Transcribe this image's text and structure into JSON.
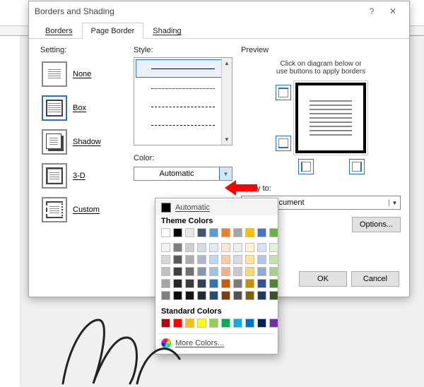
{
  "dialog": {
    "title": "Borders and Shading",
    "help_label": "?",
    "close_label": "✕"
  },
  "tabs": {
    "borders": "Borders",
    "page_border": "Page Border",
    "shading": "Shading"
  },
  "setting": {
    "heading": "Setting:",
    "none": "None",
    "box": "Box",
    "shadow": "Shadow",
    "threed": "3-D",
    "custom": "Custom"
  },
  "style": {
    "heading": "Style:",
    "color_heading": "Color:",
    "color_value": "Automatic"
  },
  "preview": {
    "heading": "Preview",
    "hint1": "Click on diagram below or",
    "hint2": "use buttons to apply borders"
  },
  "apply": {
    "heading": "Apply to:",
    "value": "Whole document"
  },
  "buttons": {
    "options": "Options...",
    "ok": "OK",
    "cancel": "Cancel"
  },
  "color_picker": {
    "automatic": "Automatic",
    "theme_heading": "Theme Colors",
    "standard_heading": "Standard Colors",
    "more": "More Colors...",
    "theme_row": [
      "#ffffff",
      "#000000",
      "#e7e6e6",
      "#44546a",
      "#5b9bd5",
      "#ed7d31",
      "#a5a5a5",
      "#ffc000",
      "#4472c4",
      "#70ad47"
    ],
    "theme_shades": [
      [
        "#f2f2f2",
        "#7f7f7f",
        "#d0cece",
        "#d6dce4",
        "#deebf6",
        "#fbe5d5",
        "#ededed",
        "#fff2cc",
        "#d9e2f3",
        "#e2efd9"
      ],
      [
        "#d8d8d8",
        "#595959",
        "#aeabab",
        "#adb9ca",
        "#bdd7ee",
        "#f7cbac",
        "#dbdbdb",
        "#fee599",
        "#b4c6e7",
        "#c5e0b3"
      ],
      [
        "#bfbfbf",
        "#3f3f3f",
        "#757070",
        "#8496b0",
        "#9cc3e5",
        "#f4b183",
        "#c9c9c9",
        "#ffd965",
        "#8eaadb",
        "#a8d08d"
      ],
      [
        "#a5a5a5",
        "#262626",
        "#3a3838",
        "#323f4f",
        "#2e75b5",
        "#c55a11",
        "#7b7b7b",
        "#bf9000",
        "#2f5496",
        "#538135"
      ],
      [
        "#7f7f7f",
        "#0c0c0c",
        "#171616",
        "#222a35",
        "#1e4e79",
        "#833c0b",
        "#525252",
        "#7f6000",
        "#1f3864",
        "#375623"
      ]
    ],
    "standard": [
      "#c00000",
      "#ff0000",
      "#ffc000",
      "#ffff00",
      "#92d050",
      "#00b050",
      "#00b0f0",
      "#0070c0",
      "#002060",
      "#7030a0"
    ]
  }
}
